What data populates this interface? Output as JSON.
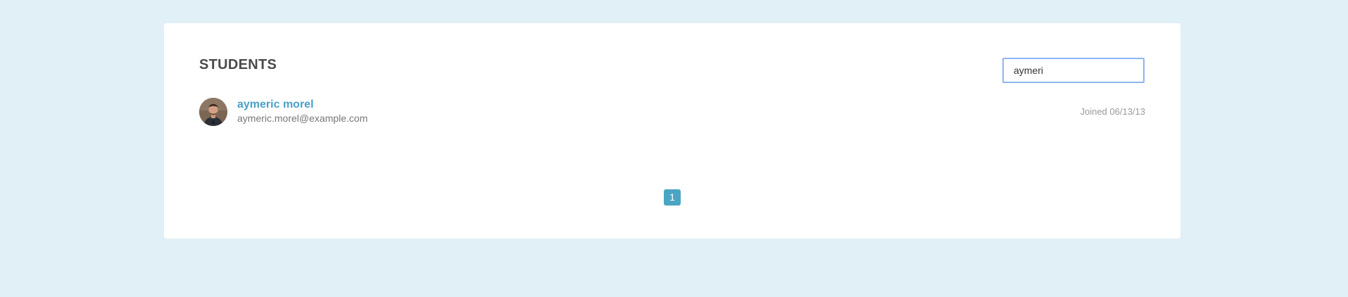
{
  "students_panel": {
    "title": "STUDENTS",
    "search": {
      "value": "aymeri",
      "placeholder": ""
    },
    "students": [
      {
        "name": "aymeric morel",
        "email": "aymeric.morel@example.com",
        "joined": "Joined 06/13/13"
      }
    ],
    "pagination": {
      "current_page": "1"
    }
  },
  "colors": {
    "background": "#e1f0f6",
    "card": "#ffffff",
    "link": "#4aa0c8",
    "pager": "#4aa5c3",
    "search_border": "#8fb5ef"
  },
  "icons": {
    "avatar": "user-avatar"
  }
}
